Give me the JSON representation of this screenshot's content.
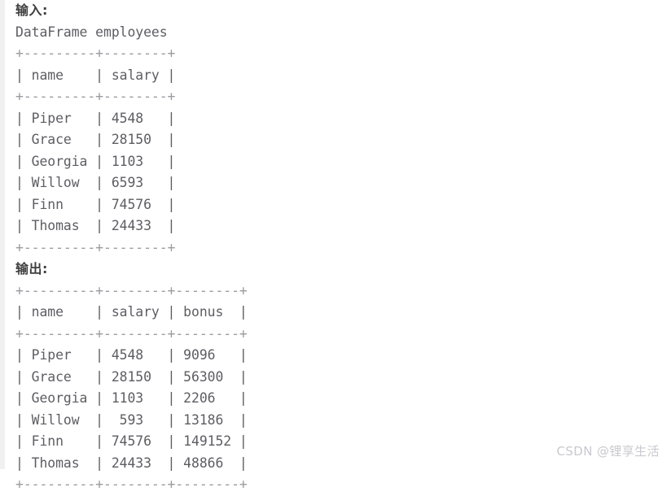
{
  "page": {
    "background_color": "#ffffff",
    "gutter_color": "#f0f0f0",
    "text_color": "#5d5d63",
    "heading_color": "#3f3f3f",
    "separator_color": "#9a9aa0",
    "watermark_color": "#c9c9cf"
  },
  "input_section": {
    "heading": "输入:",
    "caption": "DataFrame employees",
    "table": {
      "top_rule": "+---------+--------+",
      "header_row": "| name    | salary |",
      "header_rule": "+---------+--------+",
      "body_rows": [
        "| Piper   | 4548   |",
        "| Grace   | 28150  |",
        "| Georgia | 1103   |",
        "| Willow  | 6593   |",
        "| Finn    | 74576  |",
        "| Thomas  | 24433  |"
      ],
      "bottom_rule": "+---------+--------+",
      "columns": [
        "name",
        "salary"
      ],
      "rows": [
        {
          "name": "Piper",
          "salary": "4548"
        },
        {
          "name": "Grace",
          "salary": "28150"
        },
        {
          "name": "Georgia",
          "salary": "1103"
        },
        {
          "name": "Willow",
          "salary": "6593"
        },
        {
          "name": "Finn",
          "salary": "74576"
        },
        {
          "name": "Thomas",
          "salary": "24433"
        }
      ]
    }
  },
  "output_section": {
    "heading": "输出:",
    "table": {
      "top_rule": "+---------+--------+--------+",
      "header_row": "| name    | salary | bonus  |",
      "header_rule": "+---------+--------+--------+",
      "body_rows": [
        "| Piper   | 4548   | 9096   |",
        "| Grace   | 28150  | 56300  |",
        "| Georgia | 1103   | 2206   |",
        "| Willow  |  593   | 13186  |",
        "| Finn    | 74576  | 149152 |",
        "| Thomas  | 24433  | 48866  |"
      ],
      "bottom_rule": "+---------+--------+--------+",
      "columns": [
        "name",
        "salary",
        "bonus"
      ],
      "rows": [
        {
          "name": "Piper",
          "salary": "4548",
          "bonus": "9096"
        },
        {
          "name": "Grace",
          "salary": "28150",
          "bonus": "56300"
        },
        {
          "name": "Georgia",
          "salary": "1103",
          "bonus": "2206"
        },
        {
          "name": "Willow",
          "salary": "593",
          "bonus": "13186"
        },
        {
          "name": "Finn",
          "salary": "74576",
          "bonus": "149152"
        },
        {
          "name": "Thomas",
          "salary": "24433",
          "bonus": "48866"
        }
      ]
    }
  },
  "watermark": {
    "text": "CSDN @锂享生活"
  }
}
